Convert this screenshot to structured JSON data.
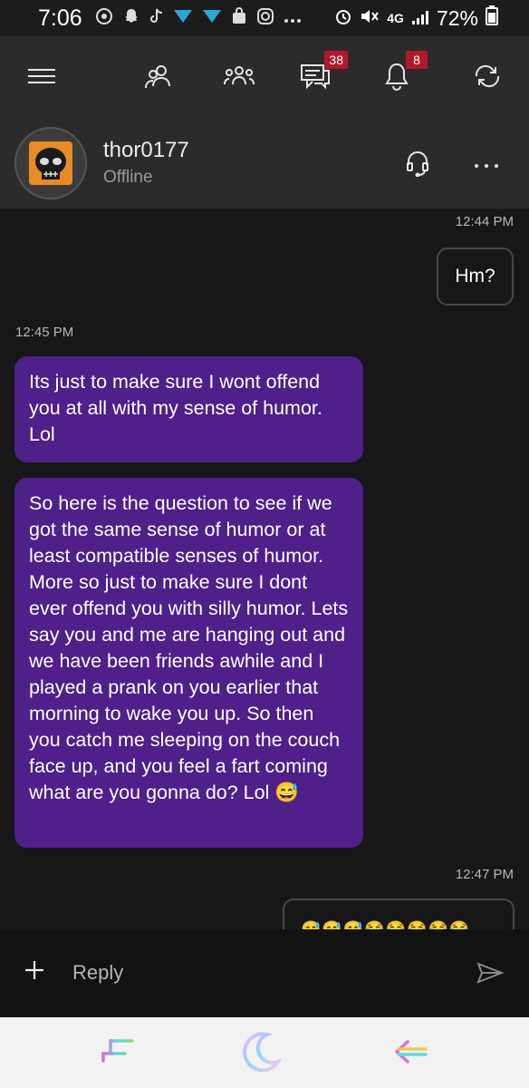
{
  "status_bar": {
    "time": "7:06",
    "network": "4G",
    "battery": "72%",
    "app_icons": [
      "chrome-icon",
      "snapchat-icon",
      "tiktok-icon",
      "vpn-icon",
      "vpn-icon",
      "bag-icon",
      "instagram-icon",
      "more-dots-icon"
    ],
    "system_icons": [
      "alarm-icon",
      "mute-icon",
      "signal-icon",
      "battery-icon"
    ]
  },
  "nav": {
    "menu_icon": "hamburger-icon",
    "friends_icon": "friends-icon",
    "party_icon": "party-icon",
    "messages_icon": "messages-icon",
    "messages_badge": "38",
    "notifications_icon": "bell-icon",
    "notifications_badge": "8",
    "sync_icon": "sync-icon",
    "badge_color": "#b3182a"
  },
  "conversation": {
    "username": "thor0177",
    "presence": "Offline",
    "call_icon": "headset-icon",
    "more_icon": "more-icon"
  },
  "messages": [
    {
      "type": "timestamp",
      "side": "right",
      "text": "12:44 PM"
    },
    {
      "type": "sent",
      "text": "Hm?"
    },
    {
      "type": "timestamp",
      "side": "left",
      "text": "12:45 PM"
    },
    {
      "type": "received",
      "text": "Its just to make sure I wont offend you at all with my sense of humor. Lol"
    },
    {
      "type": "received",
      "text": "So here is the question to see if we got the same sense of humor or at least compatible senses of humor. More so just to make sure I dont ever offend you with silly humor. Lets say you and me are hanging out and we have been friends awhile and I played a prank on you earlier that morning to wake you up. So then you catch me sleeping on the couch face up, and you feel a fart coming what are you gonna do? Lol 😅"
    },
    {
      "type": "timestamp",
      "side": "right",
      "text": "12:47 PM"
    },
    {
      "type": "sent",
      "text": "😅😅😅😂😂😂😂😂"
    }
  ],
  "composer": {
    "add_icon": "plus-icon",
    "placeholder": "Reply",
    "send_icon": "send-icon"
  },
  "system_nav": {
    "recents_icon": "recents-icon",
    "home_icon": "moon-icon",
    "back_icon": "back-arrow-icon"
  },
  "colors": {
    "received_bubble": "#4f1f8a",
    "chat_background": "#171717",
    "header_background": "#2b2b2b"
  }
}
